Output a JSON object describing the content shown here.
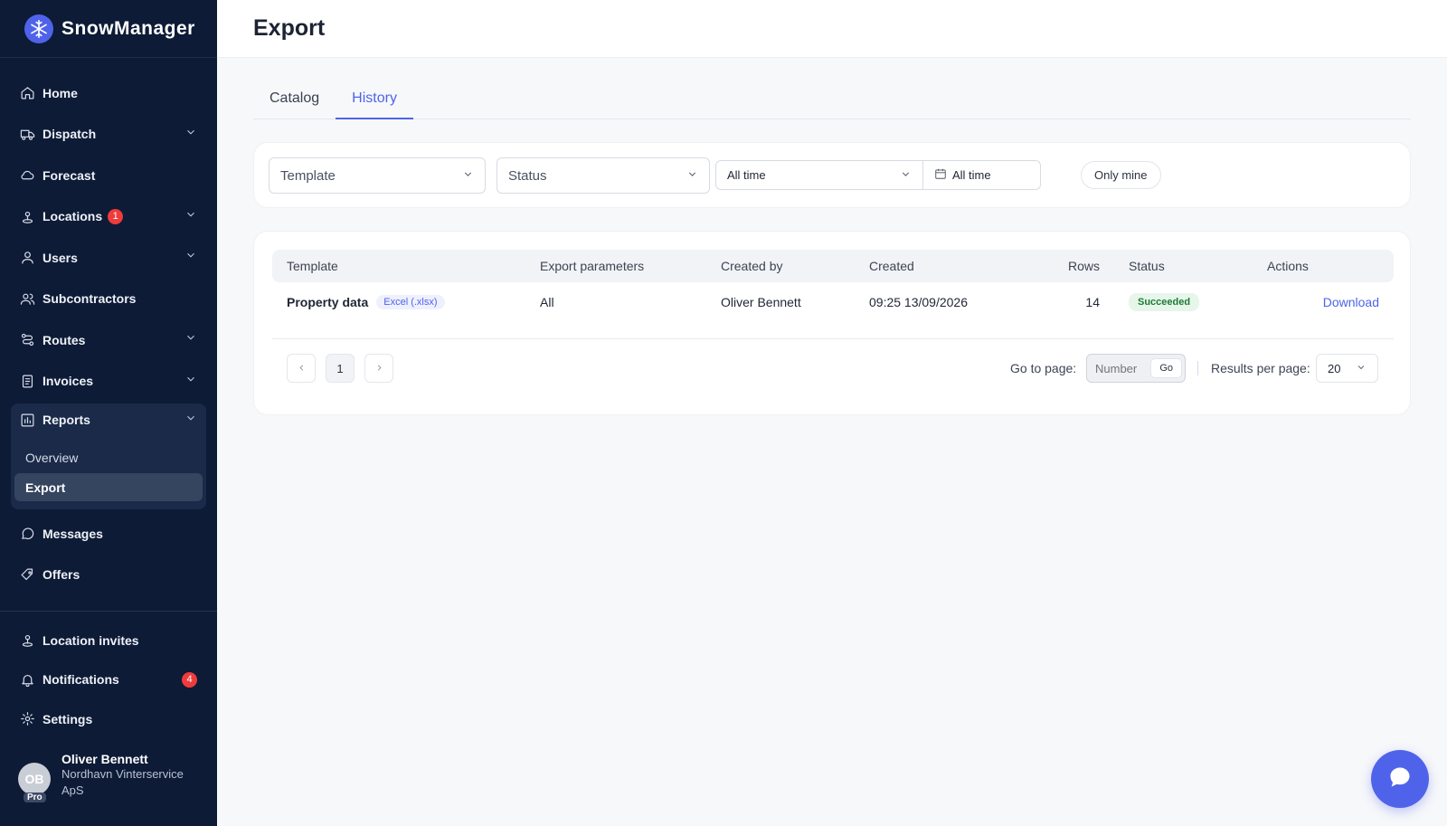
{
  "app": {
    "name": "SnowManager"
  },
  "sidebar": {
    "items": [
      {
        "label": "Home",
        "icon": "home-icon",
        "has_chevron": false
      },
      {
        "label": "Dispatch",
        "icon": "truck-icon",
        "has_chevron": true
      },
      {
        "label": "Forecast",
        "icon": "cloud-icon",
        "has_chevron": false
      },
      {
        "label": "Locations",
        "icon": "location-pin-icon",
        "has_chevron": true,
        "badge": "1"
      },
      {
        "label": "Users",
        "icon": "user-icon",
        "has_chevron": true
      },
      {
        "label": "Subcontractors",
        "icon": "users-icon",
        "has_chevron": false
      },
      {
        "label": "Routes",
        "icon": "route-icon",
        "has_chevron": true
      },
      {
        "label": "Invoices",
        "icon": "document-icon",
        "has_chevron": true
      }
    ],
    "reports": {
      "label": "Reports",
      "icon": "bar-chart-icon",
      "sub_items": [
        {
          "label": "Overview",
          "active": false
        },
        {
          "label": "Export",
          "active": true
        }
      ]
    },
    "after_items": [
      {
        "label": "Messages",
        "icon": "chat-bubble-icon"
      },
      {
        "label": "Offers",
        "icon": "offer-tag-icon"
      }
    ],
    "bottom_items": [
      {
        "label": "Location invites",
        "icon": "location-invite-icon"
      },
      {
        "label": "Notifications",
        "icon": "bell-icon",
        "badge": "4"
      },
      {
        "label": "Settings",
        "icon": "gear-icon"
      }
    ],
    "profile": {
      "initials": "OB",
      "tier": "Pro",
      "name": "Oliver Bennett",
      "org": "Nordhavn Vinterservice ApS"
    }
  },
  "page": {
    "title": "Export",
    "tabs": [
      {
        "label": "Catalog",
        "active": false
      },
      {
        "label": "History",
        "active": true
      }
    ]
  },
  "filters": {
    "template_placeholder": "Template",
    "status_placeholder": "Status",
    "period_value": "All time",
    "date_value": "All time",
    "only_mine_label": "Only mine"
  },
  "table": {
    "headers": {
      "template": "Template",
      "params": "Export parameters",
      "created_by": "Created by",
      "created": "Created",
      "rows": "Rows",
      "status": "Status",
      "actions": "Actions"
    },
    "rows": [
      {
        "template": "Property data",
        "format": "Excel (.xlsx)",
        "params": "All",
        "created_by": "Oliver Bennett",
        "created": "09:25 13/09/2026",
        "rows": "14",
        "status": "Succeeded",
        "action": "Download"
      }
    ]
  },
  "pagination": {
    "current_page": "1",
    "goto_label": "Go to page:",
    "goto_placeholder": "Number",
    "go_label": "Go",
    "rpp_label": "Results per page:",
    "rpp_value": "20"
  },
  "colors": {
    "sidebar_bg": "#0d1b36",
    "accent": "#4f63ea",
    "badge_red": "#ef3b3b",
    "success_bg": "#e6f6ea",
    "success_text": "#1e7a36"
  }
}
